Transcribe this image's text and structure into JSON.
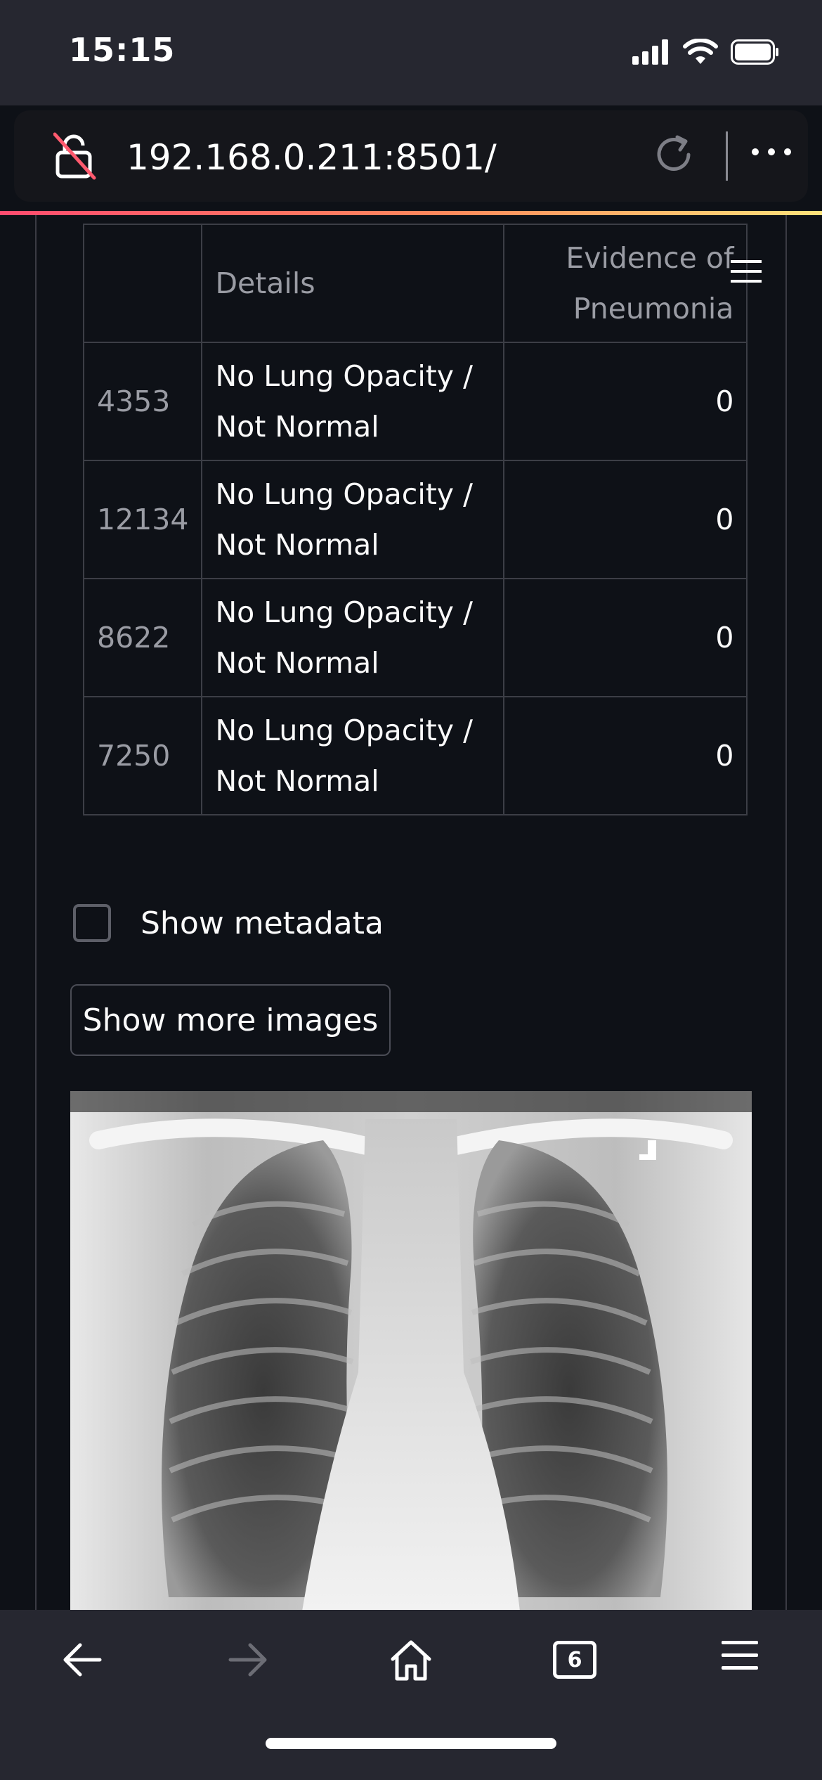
{
  "status_bar": {
    "time": "15:15"
  },
  "browser": {
    "url": "192.168.0.211:8501/",
    "tab_count": "6",
    "page_load_progress": 1.0
  },
  "table": {
    "headers": [
      "",
      "Details",
      "Evidence of Pneumonia"
    ],
    "rows": [
      {
        "index": "4353",
        "details": "No Lung Opacity / Not Normal",
        "evidence": "0"
      },
      {
        "index": "12134",
        "details": "No Lung Opacity / Not Normal",
        "evidence": "0"
      },
      {
        "index": "8622",
        "details": "No Lung Opacity / Not Normal",
        "evidence": "0"
      },
      {
        "index": "7250",
        "details": "No Lung Opacity / Not Normal",
        "evidence": "0"
      }
    ]
  },
  "controls": {
    "show_metadata_label": "Show metadata",
    "show_metadata_checked": false,
    "show_more_images_label": "Show more images"
  },
  "icons": {
    "lock": "unlocked-lock-icon",
    "reload": "reload-icon",
    "more": "more-icon",
    "menu": "hamburger-menu-icon",
    "back": "back-arrow-icon",
    "forward": "forward-arrow-icon",
    "home": "home-icon",
    "tabs": "tabs-icon",
    "browser_menu": "menu-icon"
  },
  "colors": {
    "background": "#0e1117",
    "chrome": "#262730",
    "accent_gradient": [
      "#ff4b6e",
      "#ff8a5b",
      "#ffe27a"
    ]
  }
}
